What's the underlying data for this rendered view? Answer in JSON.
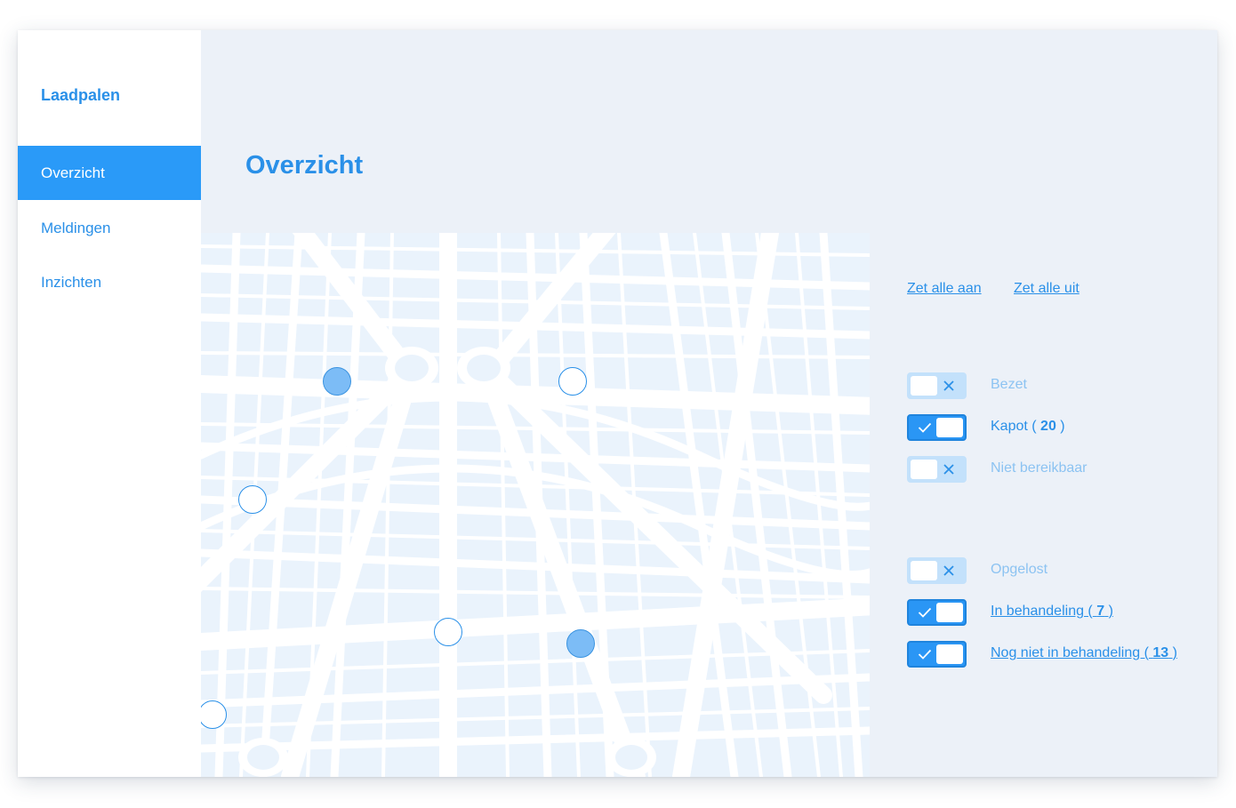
{
  "app": {
    "brand": "Laadpalen"
  },
  "sidebar": {
    "items": [
      {
        "label": "Overzicht",
        "active": true
      },
      {
        "label": "Meldingen",
        "active": false
      },
      {
        "label": "Inzichten",
        "active": false
      }
    ]
  },
  "main": {
    "title": "Overzicht"
  },
  "map": {
    "markers": [
      {
        "state": "filled"
      },
      {
        "state": "outline"
      },
      {
        "state": "outline"
      },
      {
        "state": "outline"
      },
      {
        "state": "filled"
      },
      {
        "state": "outline"
      }
    ]
  },
  "filters": {
    "all_on_label": "Zet alle aan",
    "all_off_label": "Zet alle uit",
    "status": [
      {
        "label": "Bezet",
        "on": false,
        "count": ""
      },
      {
        "label": "Kapot (",
        "on": true,
        "count": "20",
        "suffix": ")"
      },
      {
        "label": "Niet bereikbaar",
        "on": false,
        "count": ""
      }
    ],
    "handling": [
      {
        "label": "Opgelost",
        "on": false,
        "count": ""
      },
      {
        "label": "In behandeling (",
        "on": true,
        "count": "7",
        "suffix": ")"
      },
      {
        "label": "Nog niet in behandeling (",
        "on": true,
        "count": "13",
        "suffix": ")"
      }
    ]
  },
  "colors": {
    "accent": "#2a9af8",
    "text_accent": "#2a90e8",
    "background": "#ecf1f8",
    "toggle_off": "#c3e1fb",
    "marker_filled": "#7cbcf6"
  }
}
